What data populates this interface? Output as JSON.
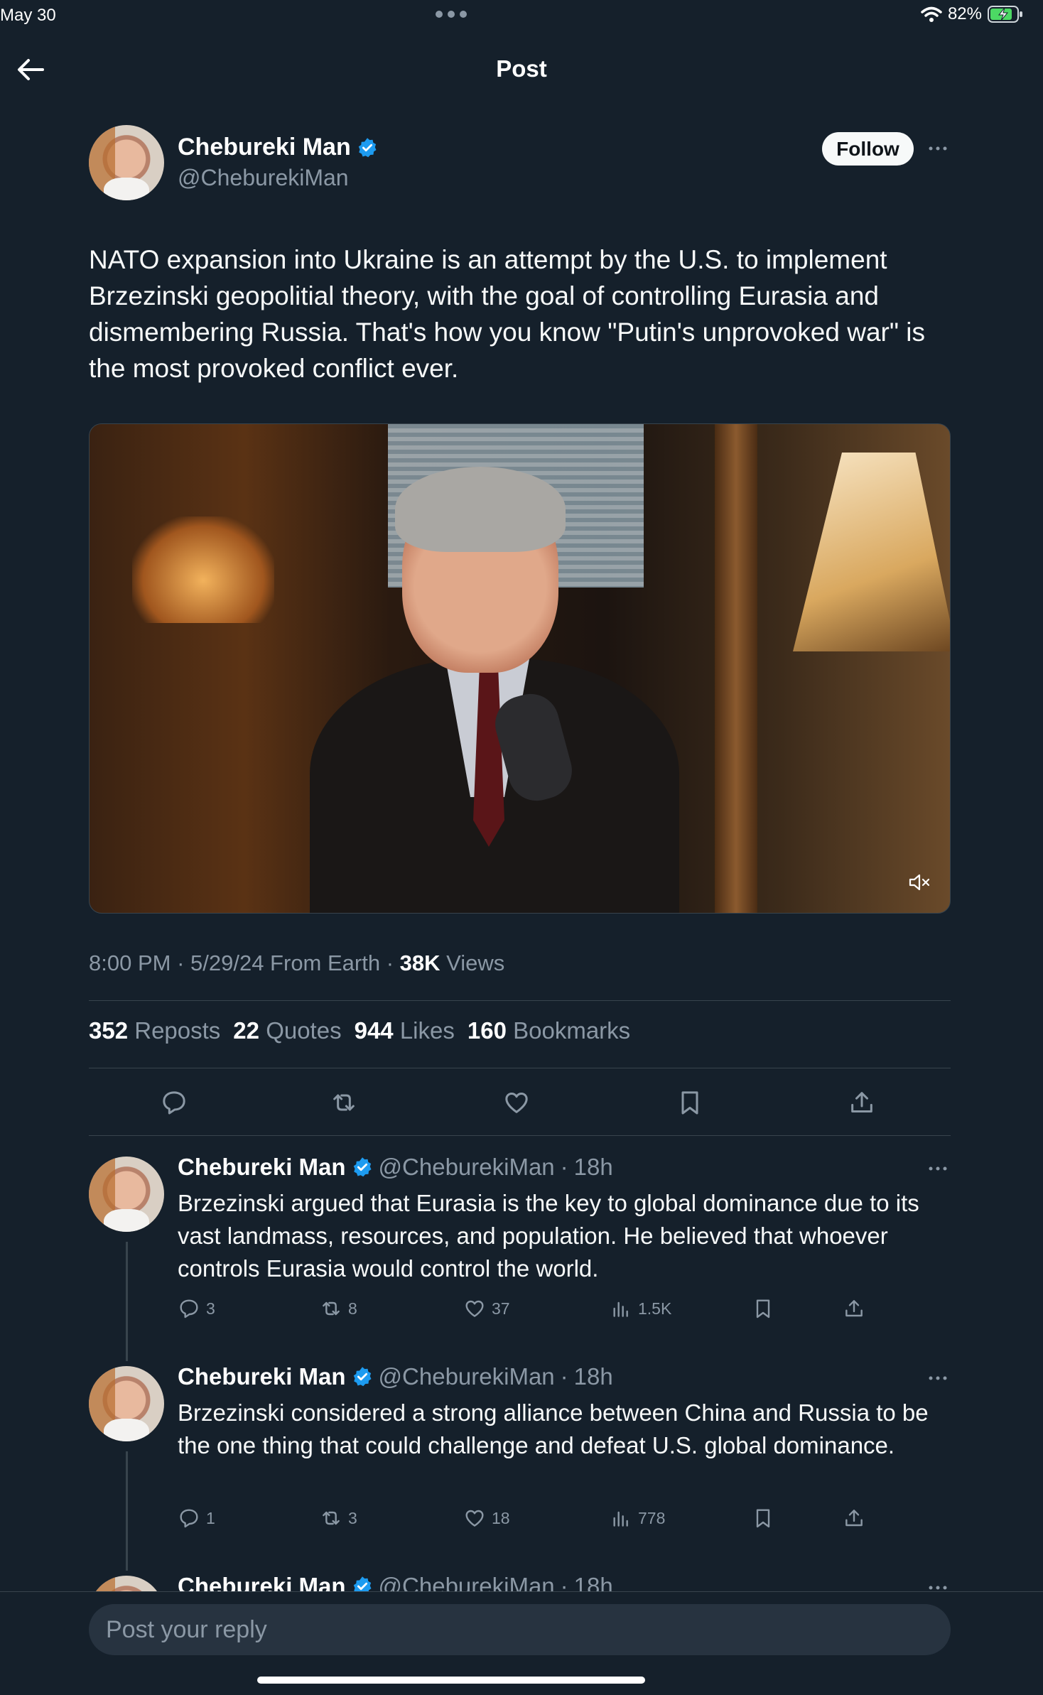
{
  "status_bar": {
    "date": "May 30",
    "battery": "82%"
  },
  "header": {
    "title": "Post"
  },
  "post": {
    "author_name": "Chebureki Man",
    "author_handle": "@CheburekiMan",
    "follow_label": "Follow",
    "text": "NATO expansion into Ukraine is an attempt by the U.S. to implement Brzezinski geopolitial theory, with the goal of controlling Eurasia and dismembering Russia. That's how you know \"Putin's unprovoked war\" is the most provoked conflict ever.",
    "time": "8:00 PM",
    "date": "5/29/24 From Earth",
    "views_count": "38K",
    "views_label": "Views",
    "stats": [
      {
        "count": "352",
        "label": "Reposts"
      },
      {
        "count": "22",
        "label": "Quotes"
      },
      {
        "count": "944",
        "label": "Likes"
      },
      {
        "count": "160",
        "label": "Bookmarks"
      }
    ]
  },
  "replies": [
    {
      "name": "Chebureki Man",
      "handle": "@CheburekiMan",
      "time": "18h",
      "text": "Brzezinski argued that Eurasia is the key to global dominance due to its vast landmass, resources, and population. He believed that whoever controls Eurasia would control the world.",
      "replies": "3",
      "reposts": "8",
      "likes": "37",
      "views": "1.5K"
    },
    {
      "name": "Chebureki Man",
      "handle": "@CheburekiMan",
      "time": "18h",
      "text": "Brzezinski considered a strong alliance between China and Russia to be the one thing that could challenge and defeat U.S. global dominance.",
      "replies": "1",
      "reposts": "3",
      "likes": "18",
      "views": "778"
    },
    {
      "name": "Chebureki Man",
      "handle": "@CheburekiMan",
      "time": "18h"
    }
  ],
  "reply_box": {
    "placeholder": "Post your reply"
  },
  "colors": {
    "background": "#15202b",
    "verified": "#1d9bf0",
    "muted": "#8b98a5",
    "divider": "#38444d"
  }
}
